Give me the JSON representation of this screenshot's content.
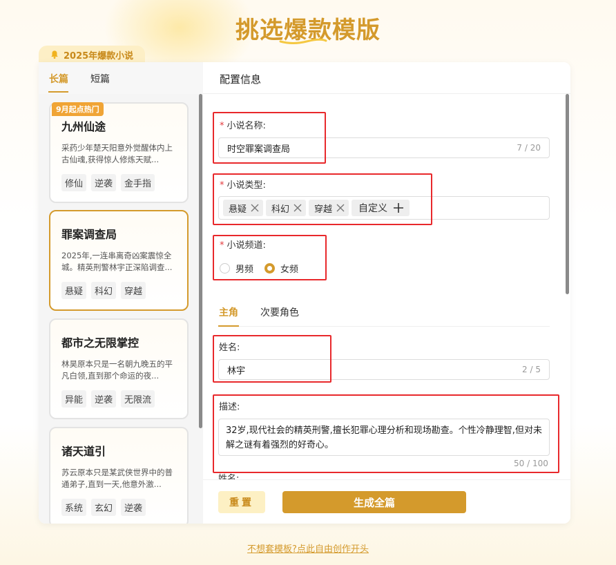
{
  "page": {
    "title": "挑选爆款模版",
    "hot_tab": "2025年爆款小说",
    "free_link": "不想套模板?点此自由创作开头"
  },
  "left": {
    "tabs": [
      {
        "label": "长篇",
        "active": true
      },
      {
        "label": "短篇",
        "active": false
      }
    ],
    "novels": [
      {
        "badge": "9月起点热门",
        "title": "九州仙途",
        "desc": "采药少年楚天阳意外觉醒体内上古仙魂,获得惊人修炼天赋...",
        "tags": [
          "修仙",
          "逆袭",
          "金手指"
        ],
        "selected": false
      },
      {
        "badge": "",
        "title": "罪案调查局",
        "desc": "2025年,一连串离奇凶案震惊全城。精英刑警林宇正深陷调查...",
        "tags": [
          "悬疑",
          "科幻",
          "穿越"
        ],
        "selected": true
      },
      {
        "badge": "",
        "title": "都市之无限掌控",
        "desc": "林昊原本只是一名朝九晚五的平凡白领,直到那个命运的夜...",
        "tags": [
          "异能",
          "逆袭",
          "无限流"
        ],
        "selected": false
      },
      {
        "badge": "",
        "title": "诸天道引",
        "desc": "苏云原本只是某武侠世界中的普通弟子,直到一天,他意外激...",
        "tags": [
          "系统",
          "玄幻",
          "逆袭"
        ],
        "selected": false
      }
    ]
  },
  "right": {
    "header": "配置信息",
    "name": {
      "required_mark": "*",
      "label": "小说名称:",
      "value": "时空罪案调查局",
      "count": "7 / 20"
    },
    "type": {
      "required_mark": "*",
      "label": "小说类型:",
      "tags": [
        "悬疑",
        "科幻",
        "穿越"
      ],
      "custom_label": "自定义"
    },
    "channel": {
      "required_mark": "*",
      "label": "小说频道:",
      "options": [
        {
          "label": "男频",
          "checked": false
        },
        {
          "label": "女频",
          "checked": true
        }
      ]
    },
    "sub_tabs": [
      {
        "label": "主角",
        "active": true
      },
      {
        "label": "次要角色",
        "active": false
      }
    ],
    "protagonist": {
      "name_label": "姓名:",
      "name_value": "林宇",
      "name_count": "2 / 5",
      "desc_label": "描述:",
      "desc_value": "32岁,现代社会的精英刑警,擅长犯罪心理分析和现场勘查。个性冷静理智,但对未解之谜有着强烈的好奇心。",
      "desc_count": "50 / 100",
      "next_label": "姓名:"
    },
    "buttons": {
      "reset": "重置",
      "generate": "生成全篇"
    }
  },
  "colors": {
    "accent": "#d49a2c",
    "highlight": "#e8282b",
    "badge": "#f0a435"
  }
}
